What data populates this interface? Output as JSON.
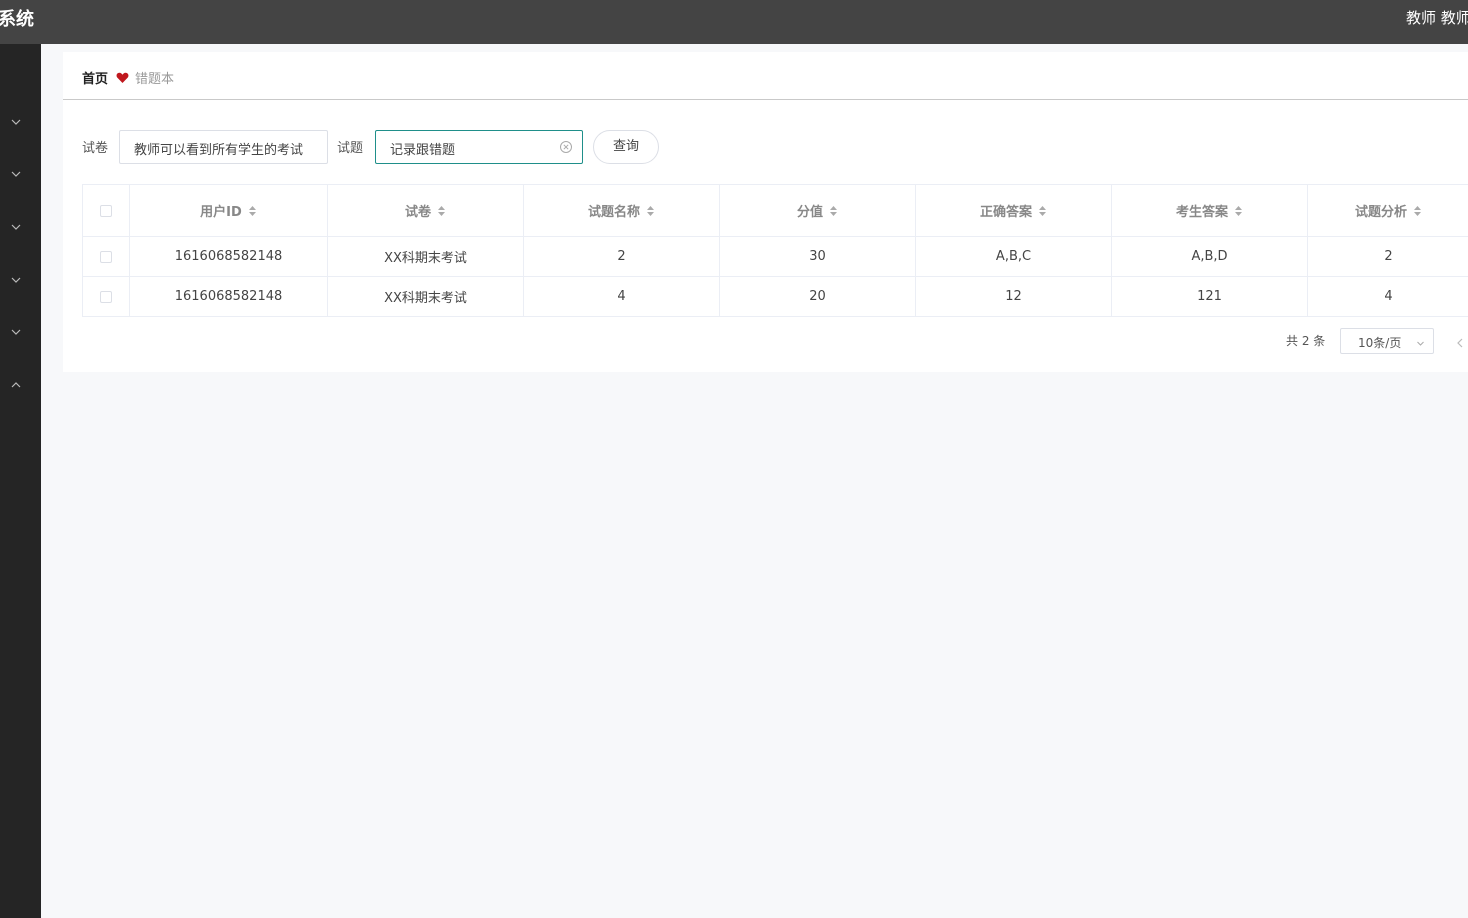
{
  "header": {
    "title": "系统",
    "user": "教师 教师"
  },
  "sidebar": {
    "icons": [
      "chevron-down-icon",
      "chevron-down-icon",
      "chevron-down-icon",
      "chevron-down-icon",
      "chevron-down-icon",
      "chevron-up-icon"
    ]
  },
  "breadcrumb": {
    "home": "首页",
    "separator_icon": "heart-icon",
    "current": "错题本"
  },
  "search": {
    "paper_label": "试卷",
    "paper_value": "教师可以看到所有学生的考试",
    "question_label": "试题",
    "question_value": "记录跟错题",
    "query_button": "查询"
  },
  "table": {
    "columns": [
      "用户ID",
      "试卷",
      "试题名称",
      "分值",
      "正确答案",
      "考生答案",
      "试题分析"
    ],
    "rows": [
      [
        "1616068582148",
        "XX科期末考试",
        "2",
        "30",
        "A,B,C",
        "A,B,D",
        "2"
      ],
      [
        "1616068582148",
        "XX科期末考试",
        "4",
        "20",
        "12",
        "121",
        "4"
      ]
    ]
  },
  "pagination": {
    "total": "共 2 条",
    "page_size": "10条/页"
  },
  "colors": {
    "topbar": "#444444",
    "sidebar": "#252525",
    "accent": "#1f8f8a",
    "heart": "#c0181e"
  }
}
